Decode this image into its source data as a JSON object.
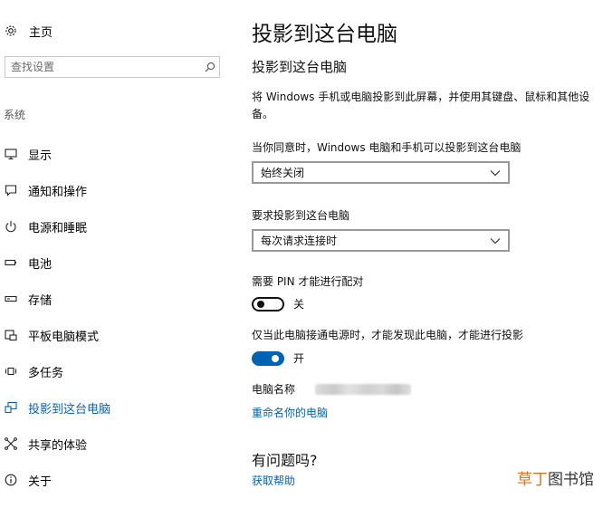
{
  "sidebar": {
    "home_label": "主页",
    "search_placeholder": "查找设置",
    "section_label": "系统",
    "items": [
      {
        "label": "显示",
        "icon": "monitor-icon"
      },
      {
        "label": "通知和操作",
        "icon": "message-icon"
      },
      {
        "label": "电源和睡眠",
        "icon": "power-icon"
      },
      {
        "label": "电池",
        "icon": "battery-icon"
      },
      {
        "label": "存储",
        "icon": "storage-icon"
      },
      {
        "label": "平板电脑模式",
        "icon": "tablet-mode-icon"
      },
      {
        "label": "多任务",
        "icon": "multitask-icon"
      },
      {
        "label": "投影到这台电脑",
        "icon": "project-icon",
        "active": true
      },
      {
        "label": "共享的体验",
        "icon": "share-icon"
      },
      {
        "label": "关于",
        "icon": "info-icon"
      }
    ]
  },
  "main": {
    "title": "投影到这台电脑",
    "subtitle": "投影到这台电脑",
    "description": "将 Windows 手机或电脑投影到此屏幕，并使用其键盘、鼠标和其他设备。",
    "consent_label": "当你同意时，Windows 电脑和手机可以投影到这台电脑",
    "consent_value": "始终关闭",
    "request_label": "要求投影到这台电脑",
    "request_value": "每次请求连接时",
    "pin_label": "需要 PIN 才能进行配对",
    "pin_state": "关",
    "power_label": "仅当此电脑接通电源时，才能发现此电脑，才能进行投影",
    "power_state": "开",
    "pc_name_label": "电脑名称",
    "rename_link": "重命名你的电脑",
    "question_title": "有问题吗?",
    "help_link": "获取帮助"
  },
  "watermark": {
    "part1": "草丁",
    "part2": "图书馆"
  },
  "colors": {
    "accent": "#0063b1"
  }
}
